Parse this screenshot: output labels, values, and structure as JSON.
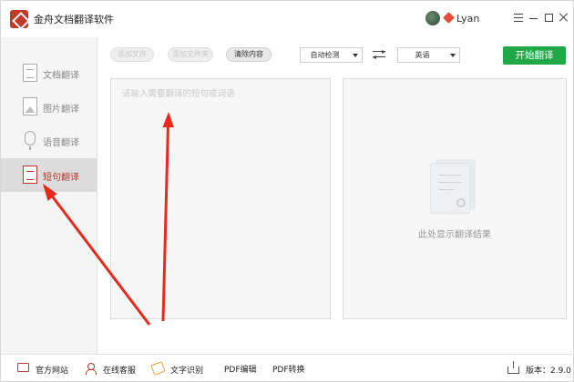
{
  "titlebar": {
    "app_title": "金舟文档翻译软件",
    "username": "Lyan"
  },
  "sidebar": {
    "items": [
      {
        "label": "文档翻译",
        "icon": "document-icon",
        "active": false
      },
      {
        "label": "图片翻译",
        "icon": "image-icon",
        "active": false
      },
      {
        "label": "语音翻译",
        "icon": "microphone-icon",
        "active": false
      },
      {
        "label": "短句翻译",
        "icon": "text-icon",
        "active": true
      }
    ]
  },
  "toolbar": {
    "add_file_label": "添加文件",
    "add_folder_label": "添加文件夹",
    "clear_label": "清除内容",
    "source_lang": "自动检测",
    "target_lang": "英语",
    "translate_label": "开始翻译"
  },
  "source_panel": {
    "placeholder": "请输入需要翻译的短句或词语"
  },
  "result_panel": {
    "empty_text": "此处显示翻译结果"
  },
  "statusbar": {
    "website_label": "官方网站",
    "service_label": "在线客服",
    "ocr_label": "文字识别",
    "pdf_edit_label": "PDF编辑",
    "pdf_convert_label": "PDF转换",
    "version_label": "版本：2.9.0"
  },
  "colors": {
    "accent_green": "#1fa845",
    "brand_red": "#c0392b",
    "annotation_red": "#e8291c"
  }
}
